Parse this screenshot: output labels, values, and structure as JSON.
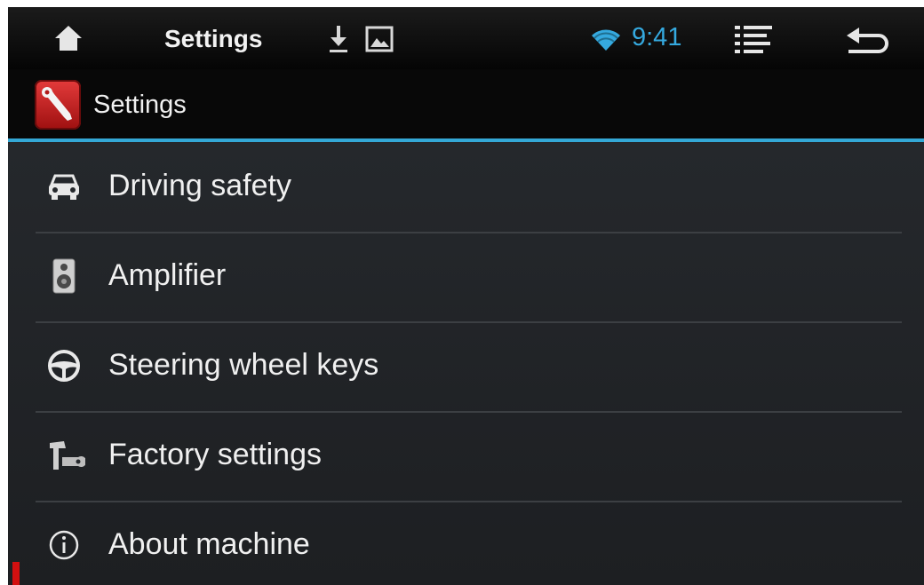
{
  "status_bar": {
    "title": "Settings",
    "time": "9:41",
    "icons": [
      "home-icon",
      "download-icon",
      "image-icon",
      "wifi-icon",
      "menu-list-icon",
      "back-icon"
    ]
  },
  "title_bar": {
    "app_title": "Settings",
    "icon": "settings-app-icon"
  },
  "menu": {
    "items": [
      {
        "label": "Driving safety",
        "icon": "car-icon"
      },
      {
        "label": "Amplifier",
        "icon": "speaker-icon"
      },
      {
        "label": "Steering wheel keys",
        "icon": "steering-wheel-icon"
      },
      {
        "label": "Factory settings",
        "icon": "tools-icon"
      },
      {
        "label": "About machine",
        "icon": "info-icon"
      }
    ]
  },
  "colors": {
    "accent": "#34a8d6",
    "background": "#1c1e21",
    "text": "#f0f0f0"
  }
}
